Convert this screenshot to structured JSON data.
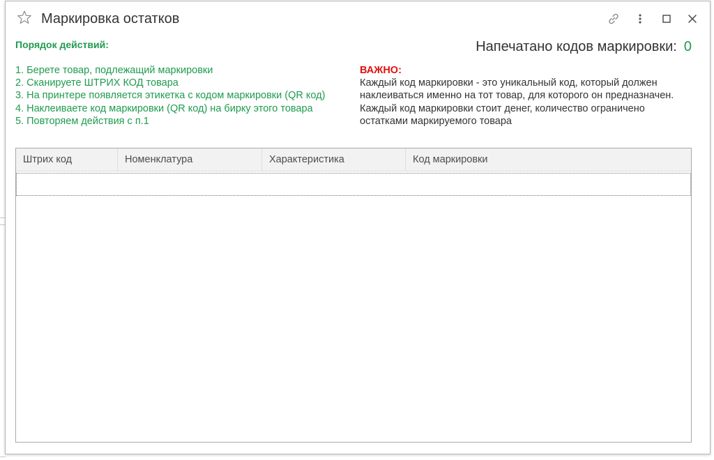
{
  "window": {
    "title": "Маркировка остатков"
  },
  "icons": {
    "favorite": "star-icon",
    "link": "link-icon",
    "more": "more-vertical-icon",
    "maximize": "maximize-icon",
    "close": "close-icon"
  },
  "instructions": {
    "title": "Порядок действий:",
    "steps": [
      "1. Берете товар, подлежащий маркировки",
      "2. Сканируете ШТРИХ КОД товара",
      "3. На принтере появляется этикетка с кодом маркировки (QR код)",
      "4. Наклеиваете код маркировки (QR код) на бирку этого товара",
      "5. Повторяем действия с п.1"
    ]
  },
  "counter": {
    "label": "Напечатано кодов маркировки:",
    "value": "0"
  },
  "important": {
    "title": "ВАЖНО:",
    "lines": [
      "Каждый код маркировки - это уникальный код, который должен наклеиваться именно на тот товар, для которого он предназначен.",
      "Каждый код маркировки стоит денег, количество ограничено остатками маркируемого товара"
    ]
  },
  "table": {
    "columns": [
      "Штрих код",
      "Номенклатура",
      "Характеристика",
      "Код маркировки"
    ],
    "rows": []
  },
  "colors": {
    "accent_green": "#1f9b4f",
    "warning_red": "#e01010",
    "text": "#333333",
    "header_bg": "#f2f2f2"
  }
}
